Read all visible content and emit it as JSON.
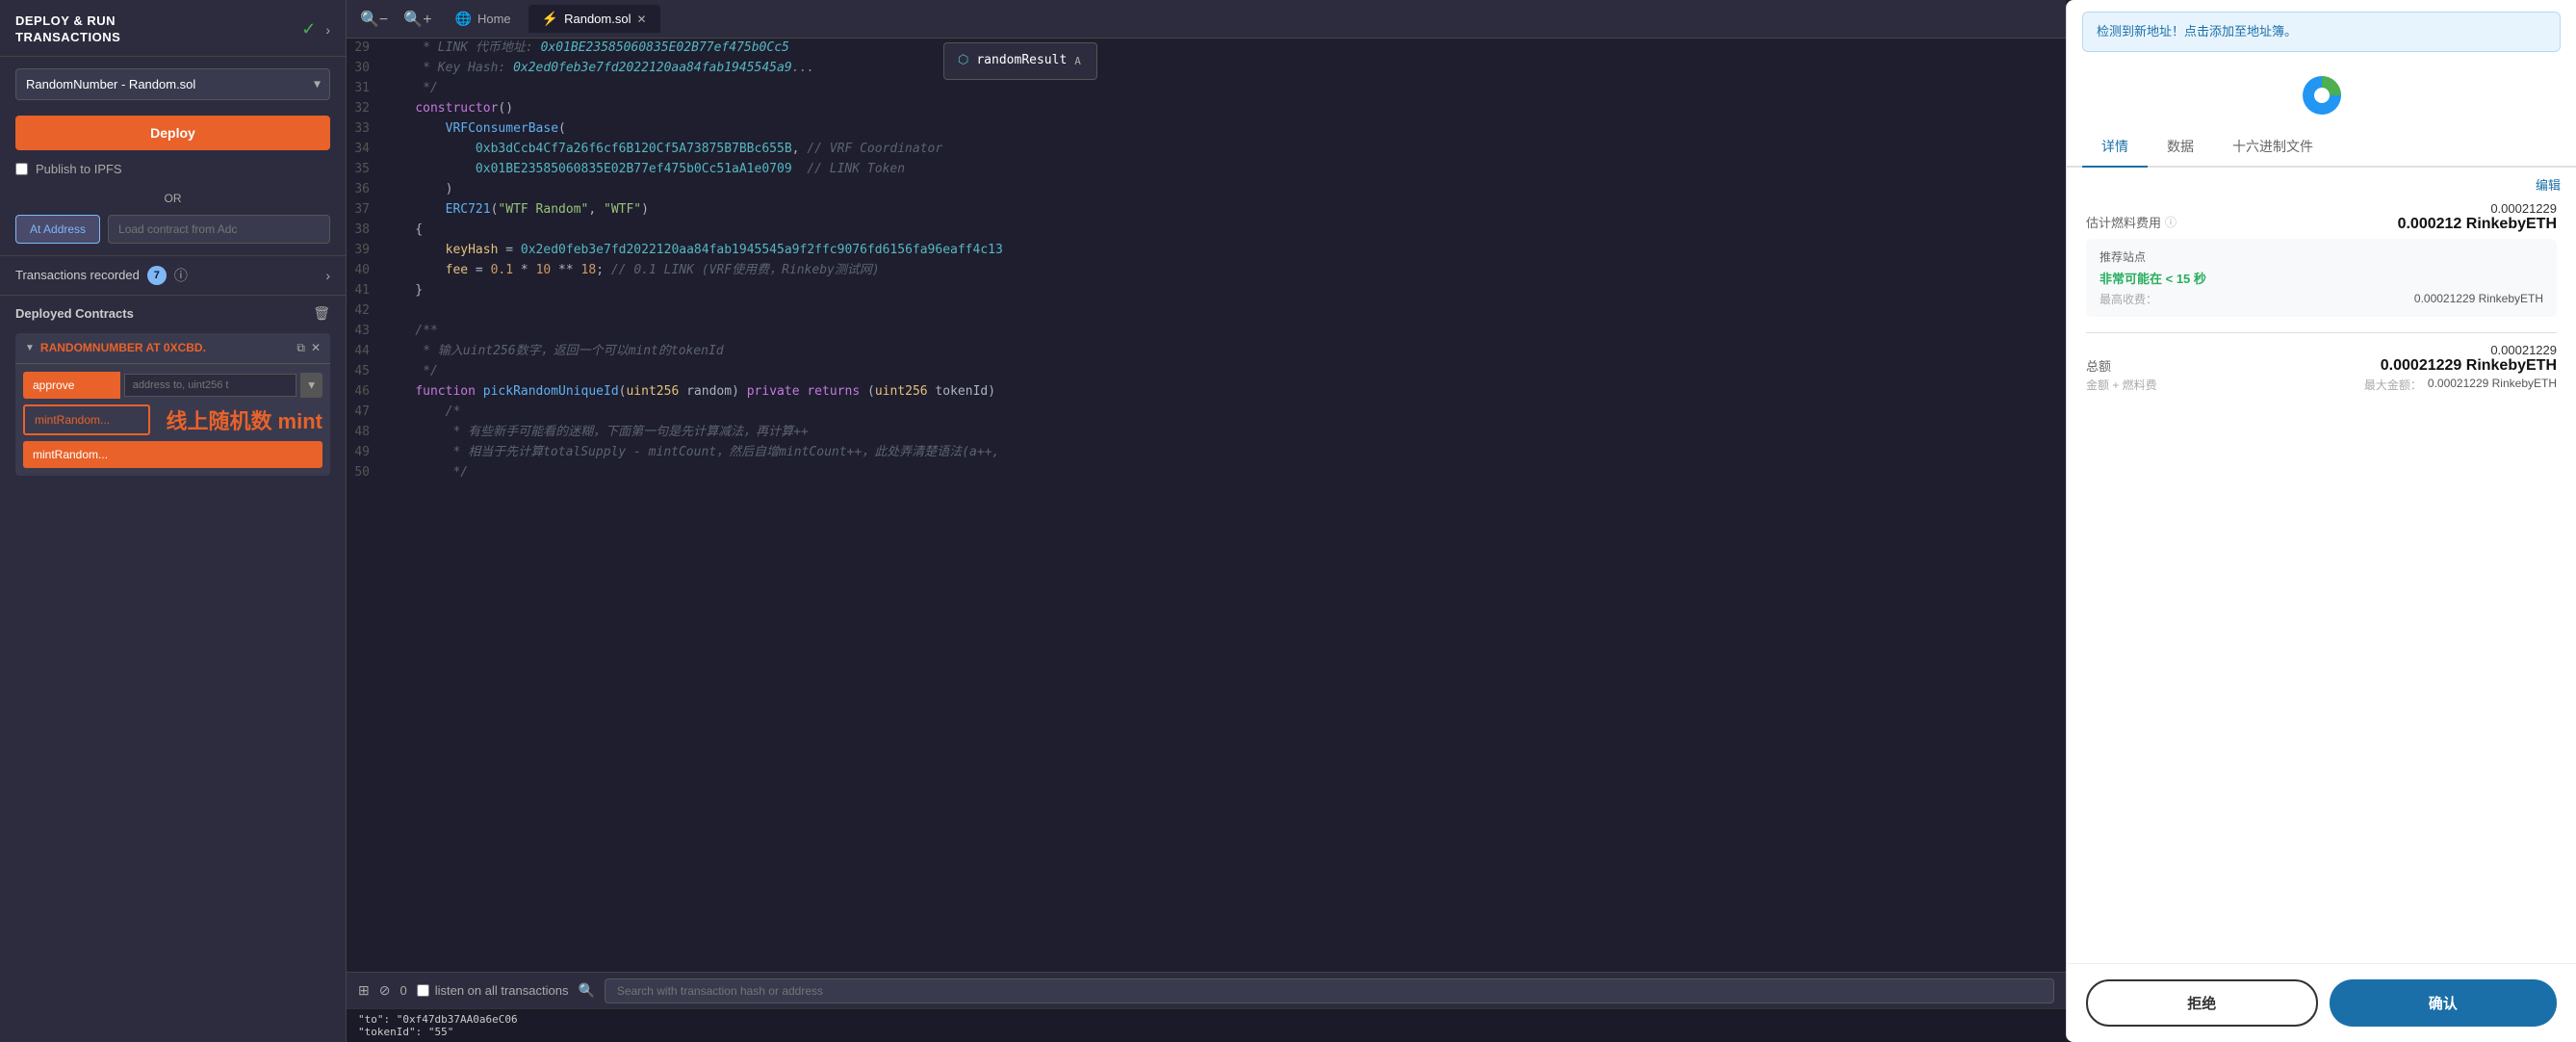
{
  "leftPanel": {
    "title": "DEPLOY & RUN\nTRANSACTIONS",
    "contractSelect": "RandomNumber - Random.sol",
    "deployBtn": "Deploy",
    "publishLabel": "Publish to IPFS",
    "orLabel": "OR",
    "atAddressBtn": "At Address",
    "loadContractPlaceholder": "Load contract from Adc",
    "transactionsLabel": "Transactions recorded",
    "transactionsBadge": "7",
    "deployedContractsLabel": "Deployed Contracts",
    "contractName": "RANDOMNUMBER AT 0XCBD.",
    "buttons": [
      {
        "label": "approve",
        "type": "orange",
        "inputPlaceholder": "address to, uint256 t"
      },
      {
        "label": "mintRandom...",
        "type": "orange-outlined",
        "annotation": "线上随机数 mint"
      },
      {
        "label": "mintRandom...",
        "type": "orange"
      }
    ]
  },
  "editor": {
    "tabs": [
      {
        "label": "Home",
        "icon": "🌐",
        "active": false
      },
      {
        "label": "Random.sol",
        "icon": "⚡",
        "active": true,
        "closeable": true
      }
    ],
    "autocomplete": "randomResult",
    "lines": [
      {
        "num": 29,
        "content": "     * LINK 代币地址: 0x01BE23585060835E02B77ef475b0Cc5",
        "comment": true
      },
      {
        "num": 30,
        "content": "     * Key Hash: 0x2ed0feb3e7fd2022120aa84fab1945545a9",
        "comment": true
      },
      {
        "num": 31,
        "content": "     */",
        "comment": true
      },
      {
        "num": 32,
        "content": "    constructor()",
        "kw": true
      },
      {
        "num": 33,
        "content": "        VRFConsumerBase(",
        "normal": true
      },
      {
        "num": 34,
        "content": "            0xb3dCcb4Cf7a26f6cf6B120Cf5A73875B7BBc655B, // VRF Coordinator",
        "addr": true
      },
      {
        "num": 35,
        "content": "            0x01BE23585060835E02B77ef475b0Cc51aA1e0709  // LINK Token",
        "addr": true
      },
      {
        "num": 36,
        "content": "        )",
        "normal": true
      },
      {
        "num": 37,
        "content": "        ERC721(\"WTF Random\", \"WTF\")",
        "normal": true
      },
      {
        "num": 38,
        "content": "    {",
        "normal": true
      },
      {
        "num": 39,
        "content": "        keyHash = 0x2ed0feb3e7fd2022120aa84fab1945545a9f2ffc9076fd6156fa96eaff4c13",
        "addr": true
      },
      {
        "num": 40,
        "content": "        fee = 0.1 * 10 ** 18; // 0.1 LINK (VRF使用费，Rinkeby测试网)",
        "comment": true
      },
      {
        "num": 41,
        "content": "    }",
        "normal": true
      },
      {
        "num": 42,
        "content": "",
        "normal": true
      },
      {
        "num": 43,
        "content": "    /**",
        "comment": true
      },
      {
        "num": 44,
        "content": "     * 输入uint256数字，返回一个可以mint的tokenId",
        "comment": true
      },
      {
        "num": 45,
        "content": "     */",
        "comment": true
      },
      {
        "num": 46,
        "content": "    function pickRandomUniqueId(uint256 random) private returns (uint256 tokenId)",
        "kw": true
      },
      {
        "num": 47,
        "content": "        /*",
        "comment": true
      },
      {
        "num": 48,
        "content": "         * 有些新手可能看的迷糊，下面第一句是先计算减法，再计算++",
        "comment": true
      },
      {
        "num": 49,
        "content": "         * 相当于先计算totalSupply - mintCount，然后自增mintCount++，此处弄清楚语法(a++,",
        "comment": true
      },
      {
        "num": 50,
        "content": "         */",
        "comment": true
      }
    ],
    "bottomBar": {
      "txCount": "0",
      "listenLabel": "listen on all transactions",
      "searchPlaceholder": "Search with transaction hash or address"
    },
    "txOutput": {
      "line1": "\"to\": \"0xf47db37AA0a6eC06",
      "line2": "\"tokenId\": \"55\""
    }
  },
  "rightPanel": {
    "notification": "检测到新地址！点击添加至地址簿。",
    "tabs": [
      "详情",
      "数据",
      "十六进制文件"
    ],
    "activeTab": 0,
    "editLabel": "编辑",
    "estimatedFeeLabel": "估计燃料费用",
    "estimatedFeeSmall": "0.00021229",
    "estimatedFeeLarge": "0.000212 RinkebyETH",
    "stationLabel": "推荐站点",
    "stationSpeed": "非常可能在 < 15 秒",
    "maxFeeLabel": "最高收费：",
    "maxFeeValue": "0.00021229 RinkebyETH",
    "totalLabel": "总额",
    "totalSmall": "0.00021229",
    "totalLarge": "0.00021229 RinkebyETH",
    "gasLabel": "金额 + 燃料费",
    "maxTotalLabel": "最大金额：",
    "maxTotalValue": "0.00021229 RinkebyETH",
    "rejectBtn": "拒绝",
    "confirmBtn": "确认"
  }
}
